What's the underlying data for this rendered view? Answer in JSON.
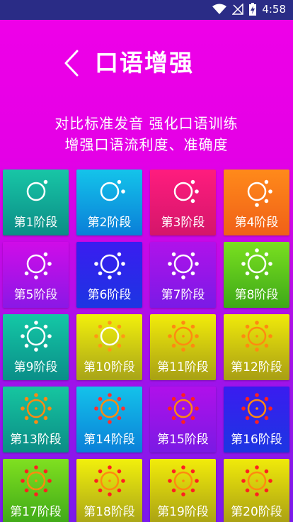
{
  "status_bar": {
    "time": "4:58"
  },
  "header": {
    "title": "口语增强"
  },
  "subtitle": {
    "line1": "对比标准发音  强化口语训练",
    "line2": "增强口语流利度、准确度"
  },
  "stages": [
    {
      "label": "第1阶段",
      "gradient": [
        "#18c6a6",
        "#0b8c86"
      ],
      "sun": "#ffffff",
      "dots": "#ffffff",
      "dots_count": 1
    },
    {
      "label": "第2阶段",
      "gradient": [
        "#14c4ea",
        "#0a7ed8"
      ],
      "sun": "#ffffff",
      "dots": "#ffffff",
      "dots_count": 2
    },
    {
      "label": "第3阶段",
      "gradient": [
        "#ff1c7e",
        "#d4166a"
      ],
      "sun": "#ffffff",
      "dots": "#ffffff",
      "dots_count": 3
    },
    {
      "label": "第4阶段",
      "gradient": [
        "#ff8a1a",
        "#f06018"
      ],
      "sun": "#ffffff",
      "dots": "#ffffff",
      "dots_count": 4
    },
    {
      "label": "第5阶段",
      "gradient": [
        "#d00ce8",
        "#8a18e6"
      ],
      "sun": "#ffffff",
      "dots": "#ffffff",
      "dots_count": 5
    },
    {
      "label": "第6阶段",
      "gradient": [
        "#3a1cf0",
        "#1c36e2"
      ],
      "sun": "#ffffff",
      "dots": "#ffffff",
      "dots_count": 6
    },
    {
      "label": "第7阶段",
      "gradient": [
        "#b012ea",
        "#7a1ae6"
      ],
      "sun": "#ffffff",
      "dots": "#ffffff",
      "dots_count": 7
    },
    {
      "label": "第8阶段",
      "gradient": [
        "#7ae020",
        "#3ea818"
      ],
      "sun": "#ffffff",
      "dots": "#ffffff",
      "dots_count": 8
    },
    {
      "label": "第9阶段",
      "gradient": [
        "#14c8a6",
        "#0a8e88"
      ],
      "sun": "#ffffff",
      "dots": "#ffffff",
      "dots_count": 8
    },
    {
      "label": "第10阶段",
      "gradient": [
        "#f2f00c",
        "#a8a418"
      ],
      "sun": "#ffffff",
      "dots": "#ff9a14",
      "dots_count": 8
    },
    {
      "label": "第11阶段",
      "gradient": [
        "#f2ec0a",
        "#a8a014"
      ],
      "sun": "#ff8a10",
      "dots": "#ff8a10",
      "dots_count": 8
    },
    {
      "label": "第12阶段",
      "gradient": [
        "#f0ea0a",
        "#a89e14"
      ],
      "sun": "#ff8a10",
      "dots": "#ff8a10",
      "dots_count": 8
    },
    {
      "label": "第13阶段",
      "gradient": [
        "#16c6a0",
        "#0b8c86"
      ],
      "sun": "#ff8a10",
      "dots": "#ff8a10",
      "dots_count": 8
    },
    {
      "label": "第14阶段",
      "gradient": [
        "#14c2ea",
        "#0a80d8"
      ],
      "sun": "#ff8a10",
      "dots": "#ff3030",
      "dots_count": 8
    },
    {
      "label": "第15阶段",
      "gradient": [
        "#b010ea",
        "#7a1ae4"
      ],
      "sun": "#ff8a10",
      "dots": "#ff2020",
      "dots_count": 8
    },
    {
      "label": "第16阶段",
      "gradient": [
        "#3a1cf0",
        "#1c36e2"
      ],
      "sun": "#ff8a10",
      "dots": "#ff2020",
      "dots_count": 8
    },
    {
      "label": "第17阶段",
      "gradient": [
        "#80e020",
        "#3ea818"
      ],
      "sun": "#ff8a10",
      "dots": "#ff2020",
      "dots_count": 8
    },
    {
      "label": "第18阶段",
      "gradient": [
        "#f2f00c",
        "#a8a418"
      ],
      "sun": "#ff8a10",
      "dots": "#ff2020",
      "dots_count": 8
    },
    {
      "label": "第19阶段",
      "gradient": [
        "#f2ec0a",
        "#a8a014"
      ],
      "sun": "#ff8a10",
      "dots": "#ff2020",
      "dots_count": 8
    },
    {
      "label": "第20阶段",
      "gradient": [
        "#f0ea0a",
        "#a89e14"
      ],
      "sun": "#ff8a10",
      "dots": "#ff2020",
      "dots_count": 8
    }
  ]
}
